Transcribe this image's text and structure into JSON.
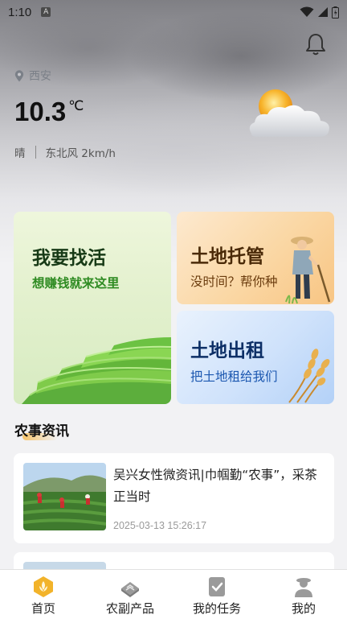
{
  "status_bar": {
    "time": "1:10",
    "notification_icon": "A"
  },
  "weather": {
    "location": "西安",
    "temperature": "10.3",
    "unit": "℃",
    "condition": "晴",
    "wind": "东北风 2km/h",
    "icon": "partly-cloudy-icon"
  },
  "cards": {
    "find_work": {
      "title": "我要找活",
      "subtitle": "想赚钱就来这里"
    },
    "land_trust": {
      "title": "土地托管",
      "subtitle": "没时间？帮你种"
    },
    "land_rent": {
      "title": "土地出租",
      "subtitle": "把土地租给我们"
    }
  },
  "news_section": {
    "title": "农事资讯",
    "items": [
      {
        "title": "吴兴女性微资讯|巾帼勤“农事”，采茶正当时",
        "time": "2025-03-13 15:26:17"
      }
    ]
  },
  "tabbar": {
    "items": [
      {
        "label": "首页",
        "icon": "home-icon",
        "active": true
      },
      {
        "label": "农副产品",
        "icon": "products-icon"
      },
      {
        "label": "我的任务",
        "icon": "tasks-icon"
      },
      {
        "label": "我的",
        "icon": "profile-icon"
      }
    ]
  },
  "colors": {
    "accent": "#f2b32a",
    "green": "#2e8b22",
    "blue": "#1b57b0"
  }
}
